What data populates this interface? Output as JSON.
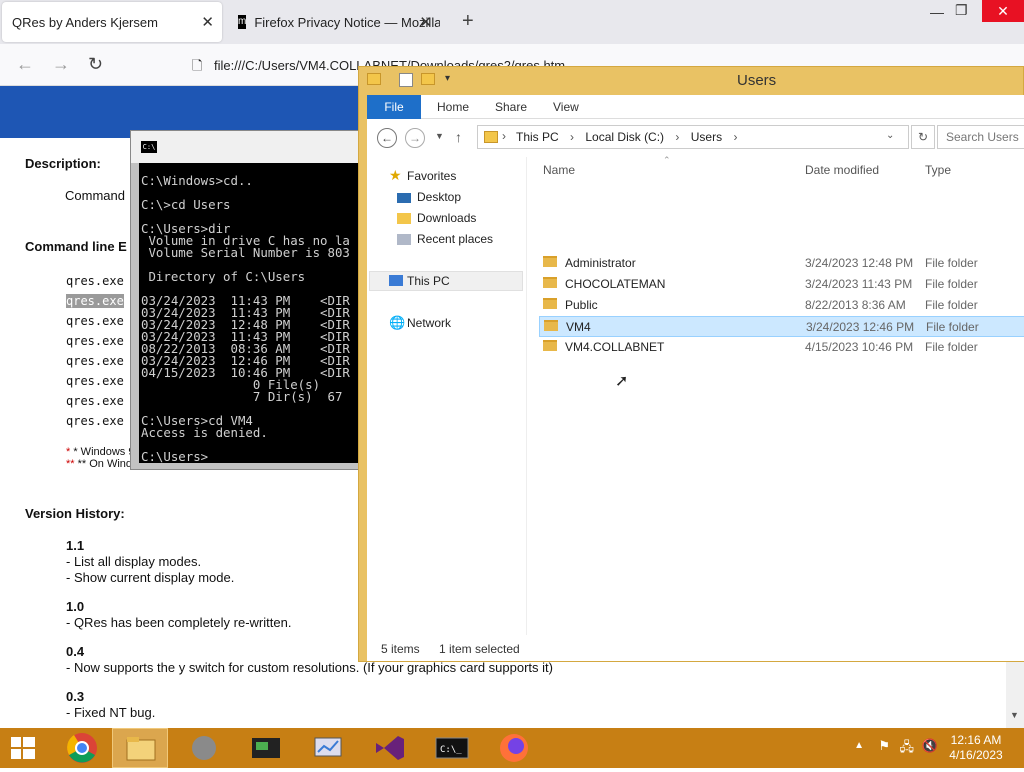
{
  "browser": {
    "tab1_title": "QRes by Anders Kjersem",
    "tab2_title": "Firefox Privacy Notice — Mozilla",
    "url": "file:///C:/Users/VM4.COLLABNET/Downloads/qres2/qres.htm"
  },
  "page": {
    "description_label": "Description:",
    "description_text": "Command",
    "cmdline_label": "Command line E",
    "cmd_rows": [
      "qres.exe",
      "qres.exe",
      "qres.exe",
      "qres.exe",
      "qres.exe",
      "qres.exe",
      "qres.exe",
      "qres.exe"
    ],
    "note1": "* Windows 9",
    "note2": "** On Windo",
    "version_label": "Version History:",
    "versions": [
      {
        "num": "1.1",
        "lines": [
          "- List all display modes.",
          "- Show current display mode."
        ]
      },
      {
        "num": "1.0",
        "lines": [
          "- QRes has been completely re-written."
        ]
      },
      {
        "num": "0.4",
        "lines": [
          "- Now supports the y switch for custom resolutions. (If your graphics card supports it)"
        ]
      },
      {
        "num": "0.3",
        "lines": [
          "- Fixed NT bug."
        ]
      }
    ]
  },
  "cmd": {
    "icon": "C:\\",
    "lines": "C:\\Windows>cd..\n\nC:\\>cd Users\n\nC:\\Users>dir\n Volume in drive C has no la\n Volume Serial Number is 803\n\n Directory of C:\\Users\n\n03/24/2023  11:43 PM    <DIR\n03/24/2023  11:43 PM    <DIR\n03/24/2023  12:48 PM    <DIR\n03/24/2023  11:43 PM    <DIR\n08/22/2013  08:36 AM    <DIR\n03/24/2023  12:46 PM    <DIR\n04/15/2023  10:46 PM    <DIR\n               0 File(s)\n               7 Dir(s)  67\n\nC:\\Users>cd VM4\nAccess is denied.\n\nC:\\Users>"
  },
  "explorer": {
    "title": "Users",
    "ribbon_tabs": [
      "File",
      "Home",
      "Share",
      "View"
    ],
    "breadcrumb": [
      "This PC",
      "Local Disk (C:)",
      "Users"
    ],
    "search_placeholder": "Search Users",
    "nav": {
      "favorites": "Favorites",
      "desktop": "Desktop",
      "downloads": "Downloads",
      "recent": "Recent places",
      "thispc": "This PC",
      "network": "Network"
    },
    "columns": [
      "Name",
      "Date modified",
      "Type"
    ],
    "rows": [
      {
        "name": "Administrator",
        "date": "3/24/2023 12:48 PM",
        "type": "File folder"
      },
      {
        "name": "CHOCOLATEMAN",
        "date": "3/24/2023 11:43 PM",
        "type": "File folder"
      },
      {
        "name": "Public",
        "date": "8/22/2013 8:36 AM",
        "type": "File folder"
      },
      {
        "name": "VM4",
        "date": "3/24/2023 12:46 PM",
        "type": "File folder"
      },
      {
        "name": "VM4.COLLABNET",
        "date": "4/15/2023 10:46 PM",
        "type": "File folder"
      }
    ],
    "selected_index": 3,
    "status_items": "5 items",
    "status_selected": "1 item selected"
  },
  "taskbar": {
    "time": "12:16 AM",
    "date": "4/16/2023"
  },
  "colors": {
    "taskbar": "#c77f14",
    "explorer_frame": "#e9c264",
    "selection": "#cce8ff",
    "banner": "#1e56b4"
  }
}
